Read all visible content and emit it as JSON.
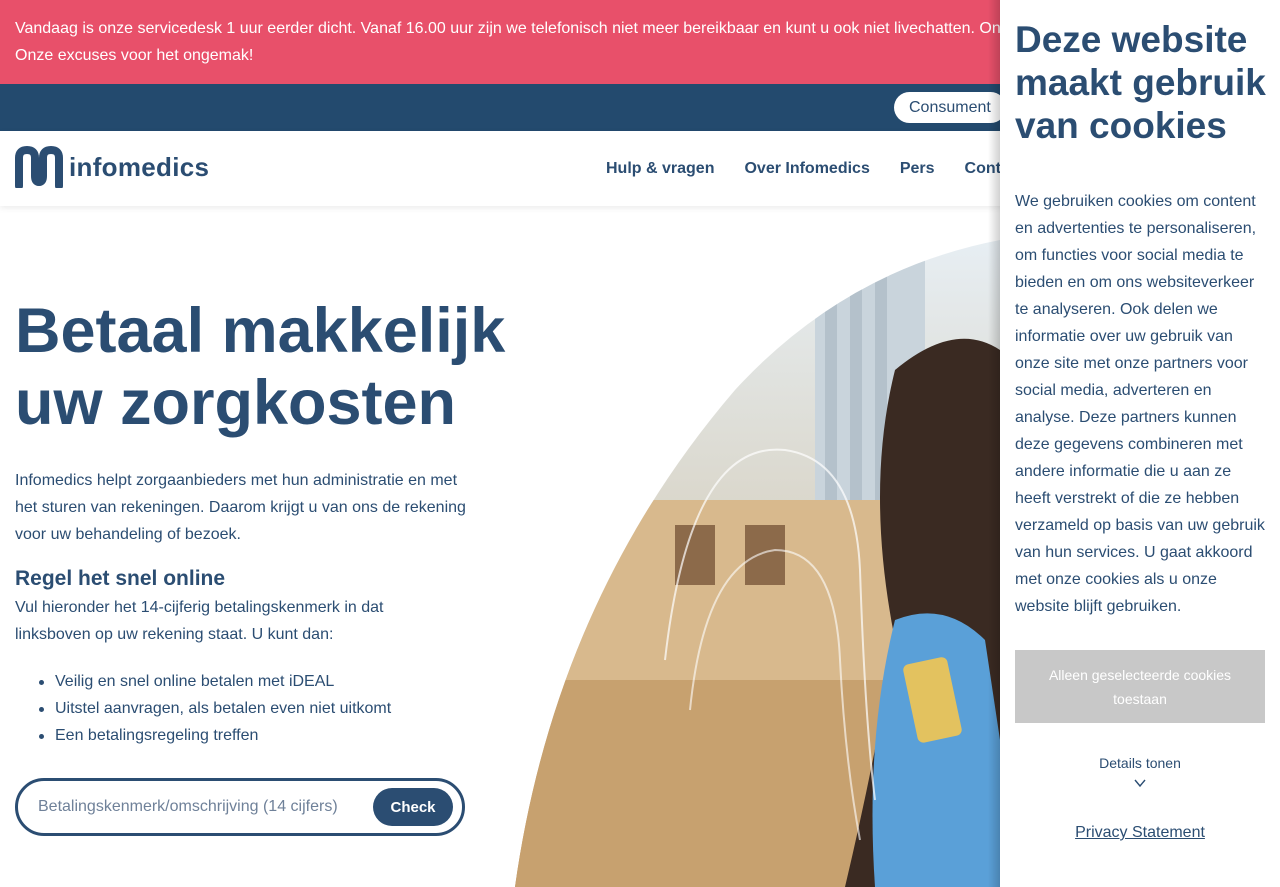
{
  "notice": {
    "line1": "Vandaag is onze servicedesk 1 uur eerder dicht. Vanaf 16.00 uur zijn we telefonisch niet meer bereikbaar en kunt u ook niet livechatten. Onze",
    "line2": "Onze excuses voor het ongemak!"
  },
  "utility": {
    "audience_label": "Consument"
  },
  "header": {
    "logo_text": "infomedics",
    "nav": [
      "Hulp & vragen",
      "Over Infomedics",
      "Pers",
      "Contac"
    ]
  },
  "hero": {
    "title_line1": "Betaal makkelijk",
    "title_line2": "uw zorgkosten",
    "intro": "Infomedics helpt zorgaanbieders met hun administratie en met het sturen van rekeningen. Daarom krijgt u van ons de rekening voor uw behandeling of bezoek.",
    "section_title": "Regel het snel online",
    "section_text": "Vul hieronder het 14-cijferig betalingskenmerk in dat linksboven op uw rekening staat. U kunt dan:",
    "bullets": [
      "Veilig en snel online betalen met iDEAL",
      "Uitstel aanvragen, als betalen even niet uitkomt",
      "Een betalingsregeling treffen"
    ],
    "search_placeholder": "Betalingskenmerk/omschrijving (14 cijfers)",
    "check_label": "Check"
  },
  "cookie": {
    "title_line1": "Deze website",
    "title_line2": "maakt gebruik",
    "title_line3": "van cookies",
    "text": "We gebruiken cookies om content en advertenties te personaliseren, om functies voor social media te bieden en om ons websiteverkeer te analyseren. Ook delen we informatie over uw gebruik van onze site met onze partners voor social media, adverteren en analyse. Deze partners kunnen deze gegevens combineren met andere informatie die u aan ze heeft verstrekt of die ze hebben verzameld op basis van uw gebruik van hun services. U gaat akkoord met onze cookies als u onze website blijft gebruiken.",
    "allow_selected_label": "Alleen geselecteerde cookies toestaan",
    "details_label": "Details tonen",
    "privacy_label": "Privacy Statement"
  },
  "colors": {
    "notice_bg": "#e8506a",
    "utility_bg": "#234a6e",
    "brand_navy": "#2b4d72",
    "cookie_button_bg": "#c8c8c8"
  },
  "icons": [
    "infomedics-logo-icon",
    "chevron-down-icon"
  ]
}
